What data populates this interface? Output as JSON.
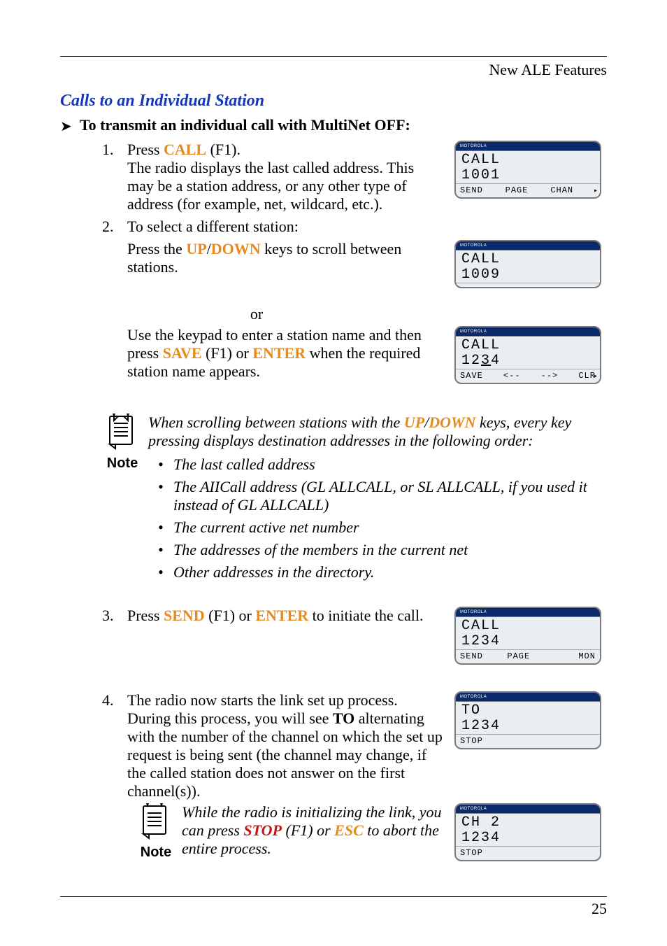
{
  "header": {
    "right": "New ALE Features"
  },
  "section_title": "Calls to an Individual Station",
  "procedure_title": "To transmit an individual call with MultiNet OFF:",
  "step1": {
    "num": "1.",
    "press": "Press ",
    "call_key": "CALL",
    "after_key": " (F1).",
    "body": "The radio displays the last called address. This may be a station address, or any other type of address (for example, net, wildcard, etc.)."
  },
  "step2": {
    "num": "2.",
    "line": "To select a different station:",
    "press_the": "Press the ",
    "up": "UP",
    "slash": "/",
    "down": "DOWN",
    "after": " keys to scroll between stations.",
    "or": "or",
    "use_keypad_pre": "Use the keypad to enter a station name and then press ",
    "save": "SAVE",
    "save_after": " (F1) or ",
    "enter": "ENTER",
    "use_keypad_post": " when the required station name appears."
  },
  "note1": {
    "label": "Note",
    "line1a": "When scrolling between stations with the ",
    "up": "UP",
    "slash": "/",
    "down": "DOWN",
    "line1b": " keys, every key pressing displays destination addresses in the following order:",
    "items": [
      "The last called address",
      "The AIICall address (GL ALLCALL, or SL ALLCALL, if you used it instead of GL ALLCALL)",
      "The current active net number",
      "The addresses of the members in the current net",
      "Other addresses in the directory."
    ]
  },
  "step3": {
    "num": "3.",
    "pre": "Press ",
    "send": "SEND",
    "mid": " (F1) or ",
    "enter": "ENTER",
    "post": " to initiate the call."
  },
  "step4": {
    "num": "4.",
    "pre": "The radio now starts the link set up process. During this process, you will see ",
    "to": "TO",
    "post": " alternating with the number of the channel on which the set up request is being sent (the channel may change, if the called station does not answer on the first channel(s))."
  },
  "note2": {
    "label": "Note",
    "pre": "While the radio is initializing the link, you can press ",
    "stop": "STOP",
    "mid": " (F1) or ",
    "esc": "ESC",
    "post": " to abort the entire process."
  },
  "lcd": {
    "brand": "MOTOROLA",
    "d1": {
      "l1": "CALL",
      "l2": "1001",
      "soft": [
        "SEND",
        "PAGE",
        "CHAN",
        ""
      ],
      "tri": "▸"
    },
    "d2": {
      "l1": "CALL",
      "l2": "1009",
      "soft": [
        "",
        "",
        "",
        ""
      ]
    },
    "d3": {
      "l1": "CALL",
      "l2_pre": "12",
      "l2_u": "3",
      "l2_post": "4",
      "soft": [
        "SAVE",
        "<--",
        "-->",
        "CLR"
      ],
      "tri": "▸"
    },
    "d4": {
      "l1": "CALL",
      "l2": "1234",
      "soft": [
        "SEND",
        "PAGE",
        "",
        "MON"
      ]
    },
    "d5": {
      "l1": "TO",
      "l2": "1234",
      "soft": [
        "STOP",
        "",
        "",
        ""
      ]
    },
    "d6": {
      "l1": "CH 2",
      "l2": "1234",
      "soft": [
        "STOP",
        "",
        "",
        ""
      ]
    }
  },
  "footer": {
    "page": "25"
  }
}
